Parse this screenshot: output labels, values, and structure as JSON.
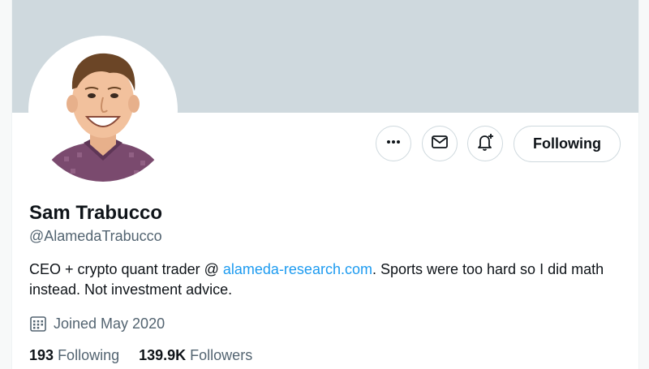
{
  "profile": {
    "display_name": "Sam Trabucco",
    "handle": "@AlamedaTrabucco",
    "bio_before_link": "CEO + crypto quant trader @ ",
    "bio_link": "alameda-research.com",
    "bio_after_link": ". Sports were too hard so I did math instead. Not investment advice.",
    "joined": "Joined May 2020",
    "following_count": "193",
    "following_label": "Following",
    "followers_count": "139.9K",
    "followers_label": "Followers"
  },
  "actions": {
    "more_icon": "more-horizontal-icon",
    "message_icon": "envelope-icon",
    "notify_icon": "bell-plus-icon",
    "follow_label": "Following"
  },
  "colors": {
    "banner": "#cfd9de",
    "link": "#1d9bf0",
    "secondary_text": "#536471",
    "primary_text": "#0f1419"
  }
}
